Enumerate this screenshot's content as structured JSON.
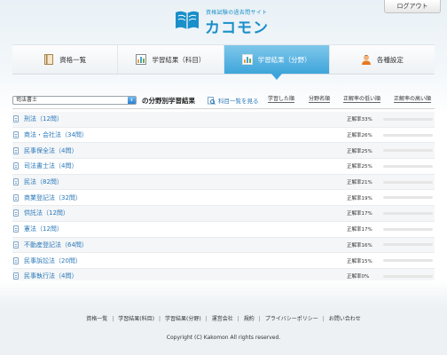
{
  "header": {
    "logout_label": "ログアウト",
    "logo_subtitle": "資格試験の過去問サイト",
    "logo_title": "カコモン"
  },
  "tabs": [
    {
      "label": "資格一覧",
      "icon": "book-icon",
      "active": false
    },
    {
      "label": "学習結果（科目）",
      "icon": "chart-icon",
      "active": false
    },
    {
      "label": "学習結果（分野）",
      "icon": "chart-icon",
      "active": true
    },
    {
      "label": "各種設定",
      "icon": "user-icon",
      "active": false
    }
  ],
  "filter": {
    "selected_exam": "司法書士",
    "section_title": "の分野別学習結果",
    "subject_link": "科目一覧を見る",
    "sort_options": [
      "学習した順",
      "分野名順",
      "正解率の低い順",
      "正解率の高い順"
    ]
  },
  "fields": [
    {
      "name": "刑法（12問）",
      "rate_label": "正解率33%",
      "rate": 33
    },
    {
      "name": "商法・会社法（34問）",
      "rate_label": "正解率26%",
      "rate": 26
    },
    {
      "name": "民事保全法（4問）",
      "rate_label": "正解率25%",
      "rate": 25
    },
    {
      "name": "司法書士法（4問）",
      "rate_label": "正解率25%",
      "rate": 25
    },
    {
      "name": "民法（82問）",
      "rate_label": "正解率21%",
      "rate": 21
    },
    {
      "name": "商業登記法（32問）",
      "rate_label": "正解率19%",
      "rate": 19
    },
    {
      "name": "供託法（12問）",
      "rate_label": "正解率17%",
      "rate": 17
    },
    {
      "name": "憲法（12問）",
      "rate_label": "正解率17%",
      "rate": 17
    },
    {
      "name": "不動産登記法（64問）",
      "rate_label": "正解率16%",
      "rate": 16
    },
    {
      "name": "民事訴訟法（20問）",
      "rate_label": "正解率15%",
      "rate": 15
    },
    {
      "name": "民事執行法（4問）",
      "rate_label": "正解率0%",
      "rate": 0
    }
  ],
  "footer": {
    "links": [
      "資格一覧",
      "学習結果(科目)",
      "学習結果(分野)",
      "運営会社",
      "規約",
      "プライバシーポリシー",
      "お問い合わせ"
    ],
    "copyright": "Copyright (C) Kakomon All rights reserved."
  },
  "colors": {
    "accent": "#1a91d6",
    "link": "#2a78b8",
    "tab_active": "#3ea5db"
  }
}
